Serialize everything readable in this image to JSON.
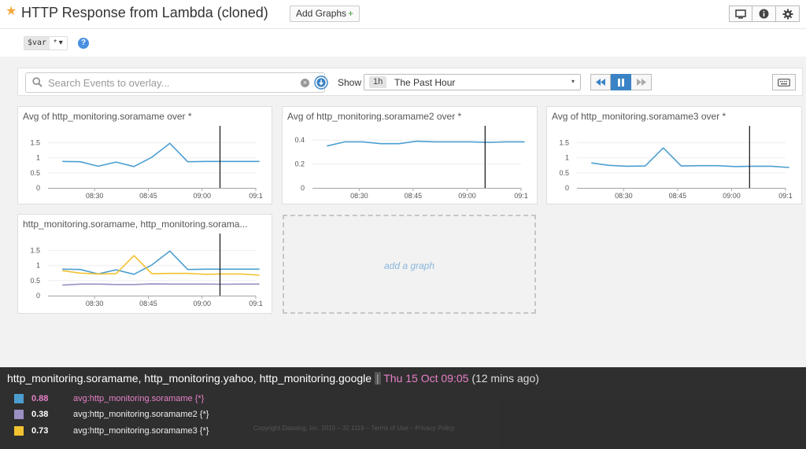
{
  "header": {
    "title": "HTTP Response from Lambda (cloned)",
    "add_graphs_label": "Add Graphs",
    "add_graphs_plus": "+",
    "tools": [
      "monitor-icon",
      "info-icon",
      "gear-icon"
    ]
  },
  "template_var": {
    "name": "$var",
    "value": "* ▾",
    "help": "?"
  },
  "controls": {
    "search_placeholder": "Search Events to overlay...",
    "show_label": "Show",
    "time_tag": "1h",
    "time_value": "The Past Hour",
    "caret": "▾"
  },
  "graphs": [
    {
      "title": "Avg of http_monitoring.soramame over *",
      "chart_data": {
        "type": "line",
        "yticks": [
          "1.5",
          "1",
          "0.5",
          "0"
        ],
        "ylim": [
          0,
          1.75
        ],
        "xticks": [
          "08:30",
          "08:45",
          "09:00",
          "09:1"
        ],
        "series": [
          {
            "color": "#4c9ed0",
            "values": [
              0.88,
              0.87,
              0.72,
              0.86,
              0.71,
              1.02,
              1.48,
              0.87,
              0.88,
              0.88,
              0.88,
              0.88
            ]
          }
        ],
        "cursor": "09:05"
      }
    },
    {
      "title": "Avg of http_monitoring.soramame2 over *",
      "chart_data": {
        "type": "line",
        "yticks": [
          "0.4",
          "0.2",
          "0"
        ],
        "ylim": [
          0,
          0.44
        ],
        "xticks": [
          "08:30",
          "08:45",
          "09:00",
          "09:1"
        ],
        "series": [
          {
            "color": "#4c9ed0",
            "values": [
              0.35,
              0.385,
              0.385,
              0.37,
              0.37,
              0.39,
              0.385,
              0.385,
              0.385,
              0.38,
              0.385,
              0.385
            ]
          }
        ],
        "cursor": "09:05"
      }
    },
    {
      "title": "Avg of http_monitoring.soramame3 over *",
      "chart_data": {
        "type": "line",
        "yticks": [
          "1.5",
          "1",
          "0.5",
          "0"
        ],
        "ylim": [
          0,
          1.75
        ],
        "xticks": [
          "08:30",
          "08:45",
          "09:00",
          "09:1"
        ],
        "series": [
          {
            "color": "#4c9ed0",
            "values": [
              0.83,
              0.75,
              0.72,
              0.73,
              1.33,
              0.73,
              0.74,
              0.74,
              0.71,
              0.72,
              0.72,
              0.68
            ]
          }
        ],
        "cursor": "09:05"
      }
    },
    {
      "title": "http_monitoring.soramame, http_monitoring.sorama...",
      "chart_data": {
        "type": "line",
        "yticks": [
          "1.5",
          "1",
          "0.5",
          "0"
        ],
        "ylim": [
          0,
          1.75
        ],
        "xticks": [
          "08:30",
          "08:45",
          "09:00",
          "09:1"
        ],
        "series": [
          {
            "color": "#4c9ed0",
            "values": [
              0.88,
              0.87,
              0.72,
              0.86,
              0.71,
              1.02,
              1.48,
              0.87,
              0.88,
              0.88,
              0.88,
              0.88
            ]
          },
          {
            "color": "#f2c230",
            "values": [
              0.83,
              0.75,
              0.72,
              0.73,
              1.33,
              0.73,
              0.74,
              0.74,
              0.71,
              0.72,
              0.72,
              0.68
            ]
          },
          {
            "color": "#9b8fc3",
            "values": [
              0.35,
              0.385,
              0.385,
              0.37,
              0.37,
              0.39,
              0.385,
              0.385,
              0.385,
              0.38,
              0.385,
              0.385
            ]
          }
        ],
        "cursor": "09:05"
      }
    }
  ],
  "add_graph_label": "add a graph",
  "tooltip": {
    "metrics": "http_monitoring.soramame, http_monitoring.yahoo, http_monitoring.google",
    "separator": "|",
    "time": "Thu 15 Oct 09:05",
    "ago": "(12 mins ago)",
    "rows": [
      {
        "color": "#4c9ed0",
        "value": "0.88",
        "name": "avg:http_monitoring.soramame {*}",
        "highlight": true
      },
      {
        "color": "#9b8fc3",
        "value": "0.38",
        "name": "avg:http_monitoring.soramame2 {*}",
        "highlight": false
      },
      {
        "color": "#f2c230",
        "value": "0.73",
        "name": "avg:http_monitoring.soramame3 {*}",
        "highlight": false
      }
    ]
  },
  "footer": {
    "copyright": "Copyright Datadog, Inc. 2015 – 32.1119 –",
    "terms": "Terms of Use",
    "dash": "–",
    "privacy": "Privacy Policy"
  }
}
